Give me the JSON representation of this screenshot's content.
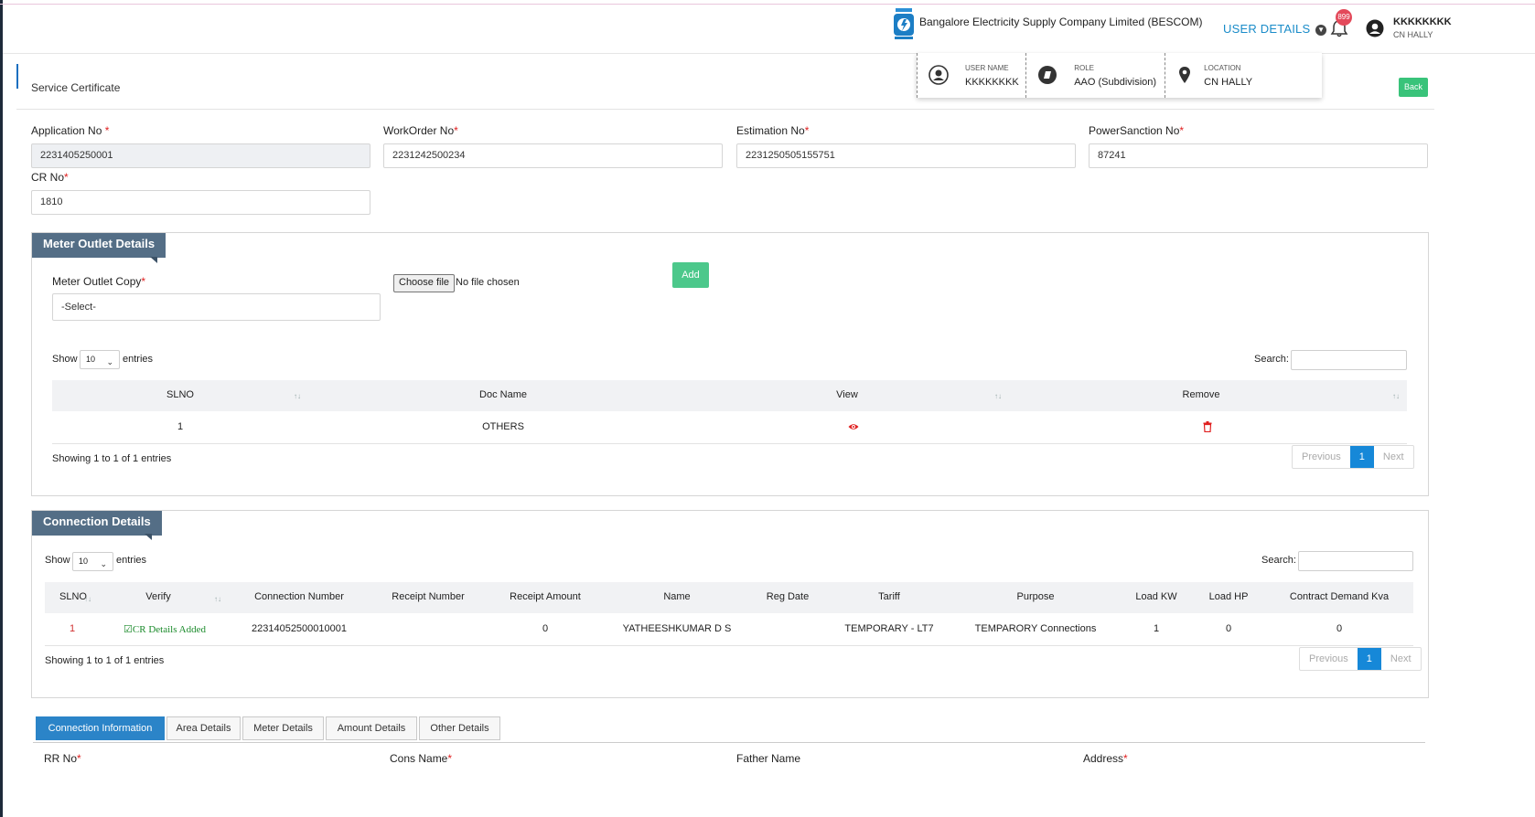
{
  "header": {
    "company": "Bangalore Electricity Supply Company Limited (BESCOM)",
    "user_details_label": "USER DETAILS",
    "notification_count": "899",
    "user_name": "KKKKKKKK",
    "user_location": "CN HALLY"
  },
  "user_popup": {
    "items": [
      {
        "label": "USER NAME",
        "value": "KKKKKKKK",
        "icon": "user-circle-icon"
      },
      {
        "label": "ROLE",
        "value": "AAO (Subdivision)",
        "icon": "role-icon"
      },
      {
        "label": "LOCATION",
        "value": "CN HALLY",
        "icon": "map-pin-icon"
      }
    ]
  },
  "page": {
    "title": "Service Certificate",
    "back_label": "Back"
  },
  "form": {
    "application_no": {
      "label": "Application No",
      "value": "2231405250001"
    },
    "workorder_no": {
      "label": "WorkOrder No",
      "value": "2231242500234"
    },
    "estimation_no": {
      "label": "Estimation No",
      "value": "2231250505155751"
    },
    "powersanction_no": {
      "label": "PowerSanction No",
      "value": "87241"
    },
    "cr_no": {
      "label": "CR No",
      "value": "1810"
    },
    "required_mark": "*"
  },
  "meter_outlet": {
    "title": "Meter Outlet Details",
    "copy_label": "Meter Outlet Copy",
    "select_value": "-Select-",
    "choose_file": "Choose file",
    "no_file": "No file chosen",
    "add_label": "Add",
    "show_label": "Show",
    "entries_label": "entries",
    "page_length": "10",
    "search_label": "Search:",
    "columns": [
      "SLNO",
      "Doc Name",
      "View",
      "Remove"
    ],
    "rows": [
      {
        "slno": "1",
        "doc_name": "OTHERS"
      }
    ],
    "info": "Showing 1 to 1 of 1 entries",
    "pager": {
      "previous": "Previous",
      "current": "1",
      "next": "Next"
    }
  },
  "connection": {
    "title": "Connection Details",
    "show_label": "Show",
    "entries_label": "entries",
    "page_length": "10",
    "search_label": "Search:",
    "columns": [
      "SLNO",
      "Verify",
      "Connection Number",
      "Receipt Number",
      "Receipt Amount",
      "Name",
      "Reg Date",
      "Tariff",
      "Purpose",
      "Load KW",
      "Load HP",
      "Contract Demand Kva"
    ],
    "rows": [
      {
        "slno": "1",
        "verify": "CR Details Added",
        "connection_number": "22314052500010001",
        "receipt_number": "",
        "receipt_amount": "0",
        "name": "YATHEESHKUMAR D S",
        "reg_date": "",
        "tariff": "TEMPORARY - LT7",
        "purpose": "TEMPARORY Connections",
        "load_kw": "1",
        "load_hp": "0",
        "contract_demand": "0"
      }
    ],
    "info": "Showing 1 to 1 of 1 entries",
    "pager": {
      "previous": "Previous",
      "current": "1",
      "next": "Next"
    }
  },
  "tabs": [
    "Connection Information",
    "Area Details",
    "Meter Details",
    "Amount Details",
    "Other Details"
  ],
  "bottom_fields": [
    "RR No",
    "Cons Name",
    "Father Name",
    "Address"
  ],
  "colors": {
    "accent": "#1688d8",
    "panel_tab": "#546e86",
    "success": "#4cc88b",
    "danger": "#e02020"
  }
}
